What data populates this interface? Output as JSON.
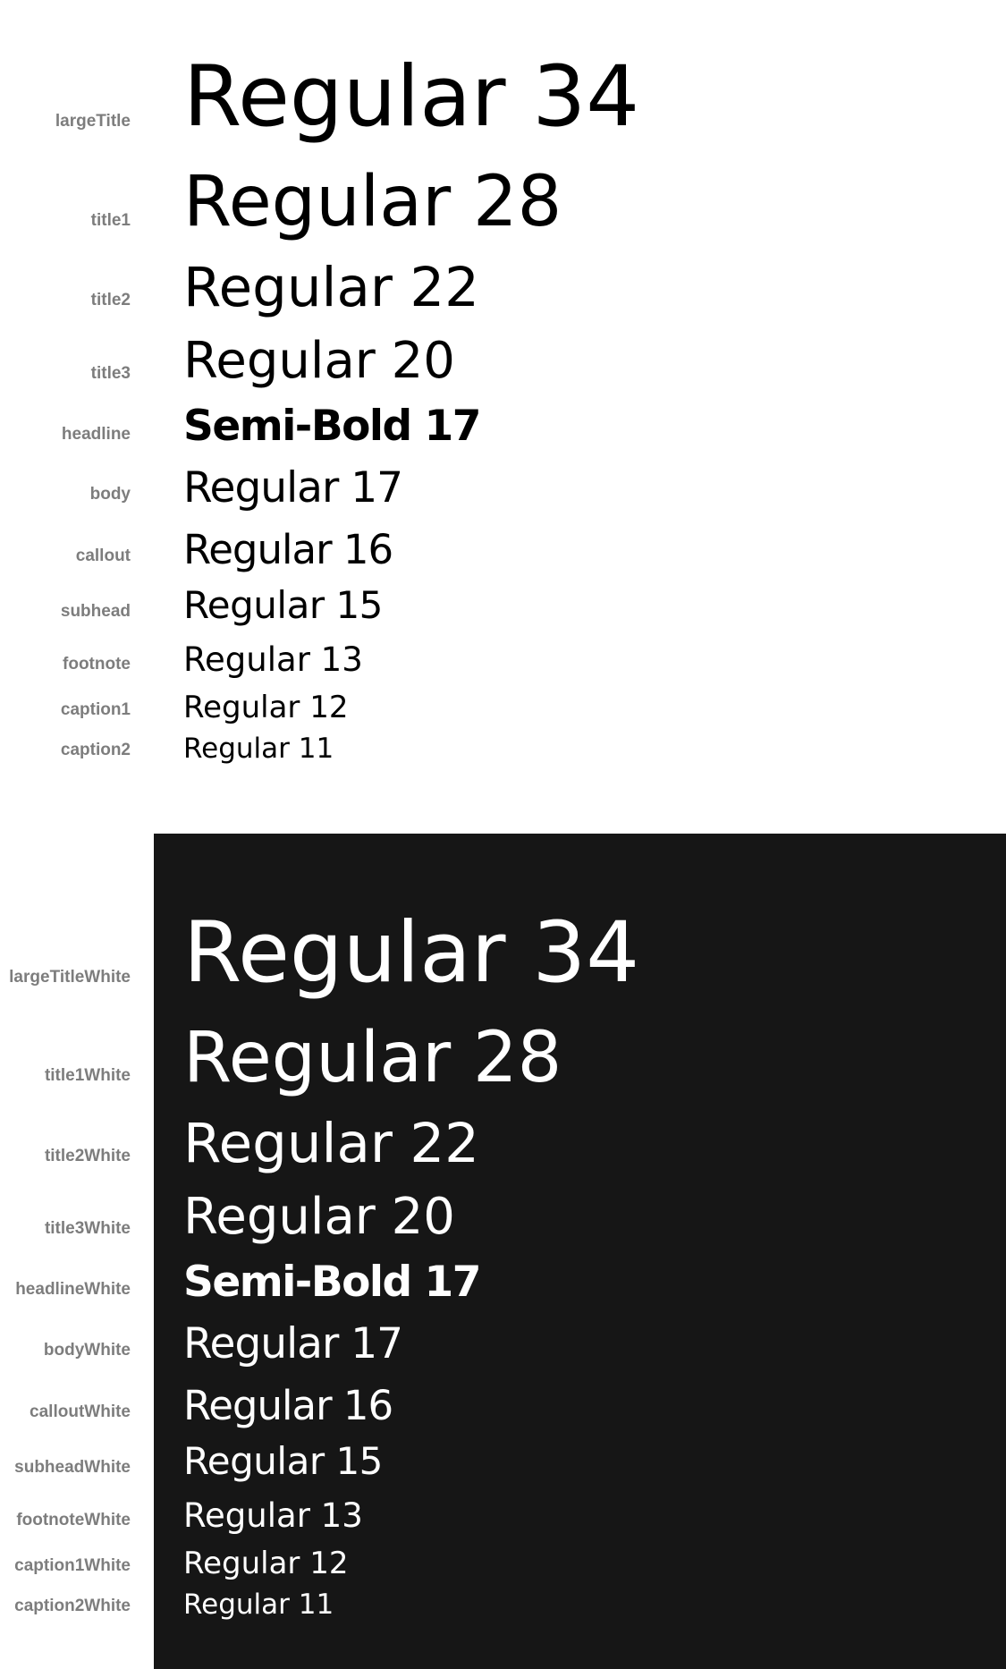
{
  "light": {
    "rows": [
      {
        "label": "largeTitle",
        "sample": "Regular 34"
      },
      {
        "label": "title1",
        "sample": "Regular 28"
      },
      {
        "label": "title2",
        "sample": "Regular 22"
      },
      {
        "label": "title3",
        "sample": "Regular 20"
      },
      {
        "label": "headline",
        "sample": "Semi-Bold 17"
      },
      {
        "label": "body",
        "sample": "Regular 17"
      },
      {
        "label": "callout",
        "sample": "Regular 16"
      },
      {
        "label": "subhead",
        "sample": "Regular 15"
      },
      {
        "label": "footnote",
        "sample": "Regular 13"
      },
      {
        "label": "caption1",
        "sample": "Regular 12"
      },
      {
        "label": "caption2",
        "sample": "Regular 11"
      }
    ]
  },
  "dark": {
    "rows": [
      {
        "label": "largeTitleWhite",
        "sample": "Regular 34"
      },
      {
        "label": "title1White",
        "sample": "Regular 28"
      },
      {
        "label": "title2White",
        "sample": "Regular 22"
      },
      {
        "label": "title3White",
        "sample": "Regular 20"
      },
      {
        "label": "headlineWhite",
        "sample": "Semi-Bold 17"
      },
      {
        "label": "bodyWhite",
        "sample": "Regular 17"
      },
      {
        "label": "calloutWhite",
        "sample": "Regular 16"
      },
      {
        "label": "subheadWhite",
        "sample": "Regular 15"
      },
      {
        "label": "footnoteWhite",
        "sample": "Regular 13"
      },
      {
        "label": "caption1White",
        "sample": "Regular 12"
      },
      {
        "label": "caption2White",
        "sample": "Regular 11"
      }
    ]
  },
  "colors": {
    "background": "#ffffff",
    "dark_panel": "#161616",
    "label": "#7d7d7d",
    "text_dark": "#000000",
    "text_light": "#ffffff"
  }
}
